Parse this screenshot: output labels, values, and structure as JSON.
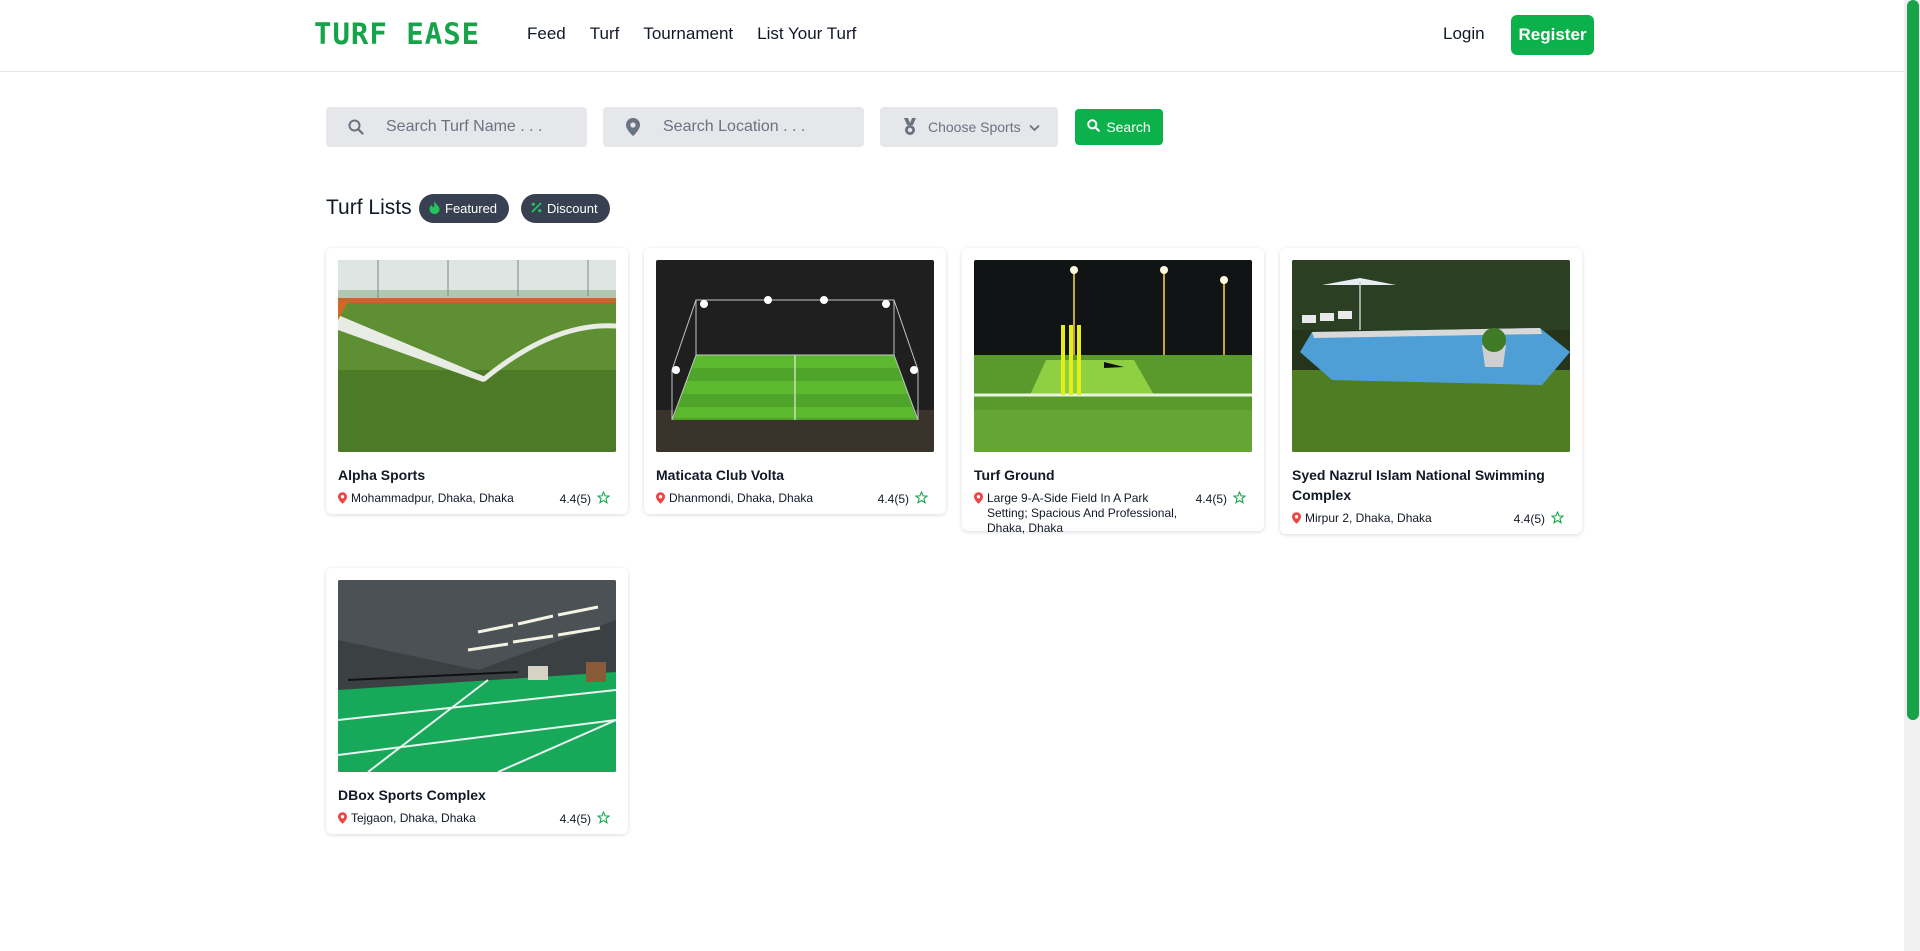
{
  "header": {
    "logo": "TURF EASE",
    "nav": [
      "Feed",
      "Turf",
      "Tournament",
      "List Your Turf"
    ],
    "login": "Login",
    "register": "Register"
  },
  "search": {
    "turf_placeholder": "Search Turf Name . . .",
    "location_placeholder": "Search Location . . .",
    "sports_label": "Choose Sports",
    "button": "Search"
  },
  "list": {
    "title": "Turf Lists",
    "filters": [
      "Featured",
      "Discount"
    ]
  },
  "turfs": [
    {
      "name": "Alpha Sports",
      "location": "Mohammadpur, Dhaka, Dhaka",
      "rating": "4.4(5)"
    },
    {
      "name": "Maticata Club Volta",
      "location": "Dhanmondi, Dhaka, Dhaka",
      "rating": "4.4(5)"
    },
    {
      "name": "Turf Ground",
      "location": "Large 9-A-Side Field In A Park Setting; Spacious And Professional, Dhaka, Dhaka",
      "rating": "4.4(5)"
    },
    {
      "name": "Syed Nazrul Islam National Swimming Complex",
      "location": "Mirpur 2, Dhaka, Dhaka",
      "rating": "4.4(5)"
    },
    {
      "name": "DBox Sports Complex",
      "location": "Tejgaon, Dhaka, Dhaka",
      "rating": "4.4(5)"
    }
  ],
  "colors": {
    "brand": "#16a34a",
    "button": "#0db14b",
    "pill": "#374151",
    "pin": "#ef4444"
  }
}
